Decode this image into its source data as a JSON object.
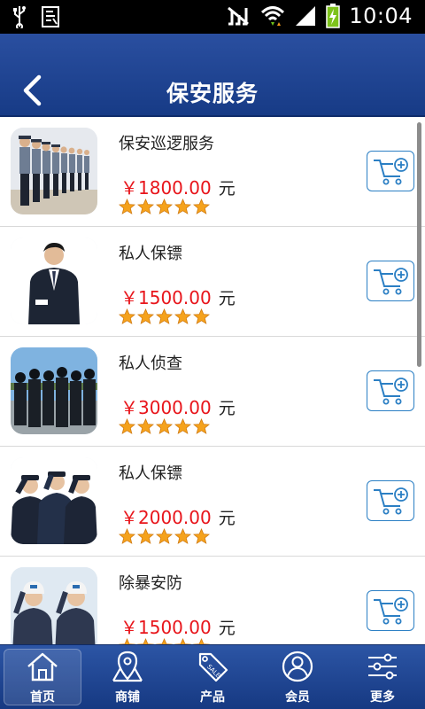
{
  "status_bar": {
    "time": "10:04",
    "icons": [
      "usb-icon",
      "sim-icon",
      "mute-icon",
      "wifi-icon",
      "signal-icon",
      "battery-charging-icon"
    ]
  },
  "header": {
    "title": "保安服务",
    "back_icon": "chevron-left-icon"
  },
  "colors": {
    "header_blue": "#1e4594",
    "price_red": "#e8151b",
    "cart_blue": "#2b7fc4",
    "star_orange": "#f5a21c"
  },
  "products": [
    {
      "name": "保安巡逻服务",
      "price": "￥1800.00",
      "unit": "元",
      "rating": 5
    },
    {
      "name": "私人保镖",
      "price": "￥1500.00",
      "unit": "元",
      "rating": 5
    },
    {
      "name": "私人侦查",
      "price": "￥3000.00",
      "unit": "元",
      "rating": 5
    },
    {
      "name": "私人保镖",
      "price": "￥2000.00",
      "unit": "元",
      "rating": 5
    },
    {
      "name": "除暴安防",
      "price": "￥1500.00",
      "unit": "元",
      "rating": 5
    }
  ],
  "bottom_nav": [
    {
      "label": "首页",
      "icon": "home-icon",
      "active": true
    },
    {
      "label": "商铺",
      "icon": "store-icon",
      "active": false
    },
    {
      "label": "产品",
      "icon": "sale-tag-icon",
      "active": false
    },
    {
      "label": "会员",
      "icon": "member-icon",
      "active": false
    },
    {
      "label": "更多",
      "icon": "settings-sliders-icon",
      "active": false
    }
  ]
}
